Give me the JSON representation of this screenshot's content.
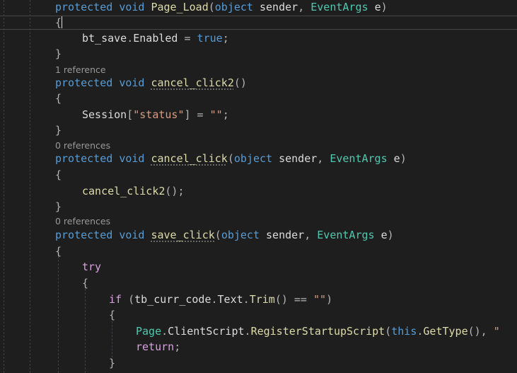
{
  "code": {
    "line1": {
      "kw1": "protected",
      "kw2": "void",
      "name": "Page_Load",
      "open": "(",
      "type1": "object",
      "p1": "sender",
      "comma": ",",
      "type2": "EventArgs",
      "p2": "e",
      "close": ")"
    },
    "line2": {
      "brace": "{"
    },
    "line3": {
      "obj": "bt_save",
      "dot": ".",
      "prop": "Enabled",
      "eq": " = ",
      "val": "true",
      "semi": ";"
    },
    "line4": {
      "brace": "}"
    },
    "ref1": "1 reference",
    "line5": {
      "kw1": "protected",
      "kw2": "void",
      "name": "cancel_click2",
      "parens": "()"
    },
    "line6": {
      "brace": "{"
    },
    "line7": {
      "obj": "Session",
      "open": "[",
      "key": "\"status\"",
      "close": "]",
      "eq": " = ",
      "val": "\"\"",
      "semi": ";"
    },
    "line8": {
      "brace": "}"
    },
    "ref2": "0 references",
    "line9": {
      "kw1": "protected",
      "kw2": "void",
      "name": "cancel_click",
      "open": "(",
      "type1": "object",
      "p1": "sender",
      "comma": ",",
      "type2": "EventArgs",
      "p2": "e",
      "close": ")"
    },
    "line10": {
      "brace": "{"
    },
    "line11": {
      "call": "cancel_click2",
      "rest": "();"
    },
    "line12": {
      "brace": "}"
    },
    "ref3": "0 references",
    "line13": {
      "kw1": "protected",
      "kw2": "void",
      "name": "save_click",
      "open": "(",
      "type1": "object",
      "p1": "sender",
      "comma": ",",
      "type2": "EventArgs",
      "p2": "e",
      "close": ")"
    },
    "line14": {
      "brace": "{"
    },
    "line15": {
      "kw": "try"
    },
    "line16": {
      "brace": "{"
    },
    "line17": {
      "kw": "if",
      "open": " (",
      "obj": "tb_curr_code",
      "dot1": ".",
      "prop": "Text",
      "dot2": ".",
      "method": "Trim",
      "args": "()",
      "eq": " == ",
      "val": "\"\"",
      "close": ")"
    },
    "line18": {
      "brace": "{"
    },
    "line19": {
      "obj": "Page",
      "dot1": ".",
      "prop": "ClientScript",
      "dot2": ".",
      "method": "RegisterStartupScript",
      "open": "(",
      "this": "this",
      "dot3": ".",
      "method2": "GetType",
      "args": "(),",
      "str": " \""
    },
    "line20": {
      "kw": "return",
      "semi": ";"
    },
    "line21": {
      "brace": "}"
    }
  }
}
